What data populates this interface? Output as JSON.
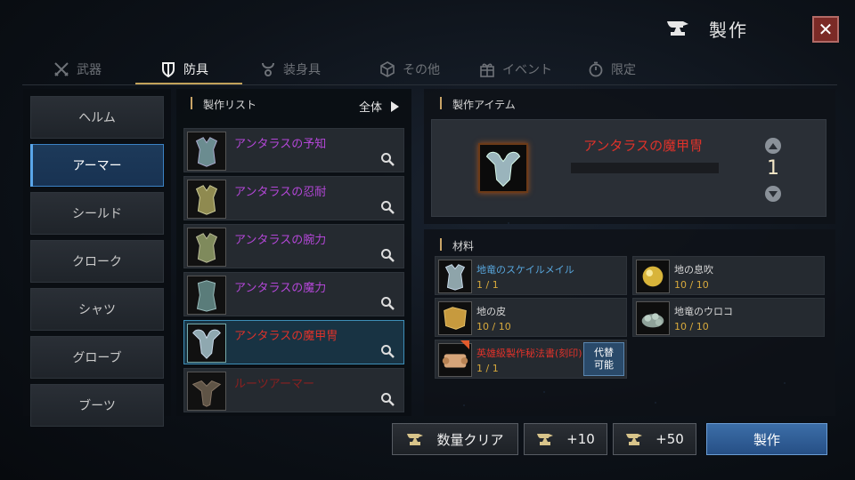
{
  "header": {
    "title": "製作",
    "icon": "anvil-icon",
    "close_icon": "close-icon"
  },
  "tabs": [
    {
      "label": "武器",
      "icon": "crossed-swords-icon",
      "active": false
    },
    {
      "label": "防具",
      "icon": "shield-icon",
      "active": true
    },
    {
      "label": "装身具",
      "icon": "necklace-icon",
      "active": false
    },
    {
      "label": "その他",
      "icon": "cube-icon",
      "active": false
    },
    {
      "label": "イベント",
      "icon": "gift-icon",
      "active": false
    },
    {
      "label": "限定",
      "icon": "stopwatch-icon",
      "active": false
    }
  ],
  "categories": [
    "ヘルム",
    "アーマー",
    "シールド",
    "クローク",
    "シャツ",
    "グローブ",
    "ブーツ"
  ],
  "selected_category": "アーマー",
  "craft_list": {
    "title": "製作リスト",
    "filter_label": "全体",
    "items": [
      {
        "name": "アンタラスの予知",
        "color": "#b447d8"
      },
      {
        "name": "アンタラスの忍耐",
        "color": "#b447d8"
      },
      {
        "name": "アンタラスの腕力",
        "color": "#b447d8"
      },
      {
        "name": "アンタラスの魔力",
        "color": "#b447d8"
      },
      {
        "name": "アンタラスの魔甲冑",
        "color": "#e0322a",
        "selected": true
      },
      {
        "name": "ルーツアーマー",
        "color": "#8a2020"
      }
    ]
  },
  "craft_item": {
    "section_title": "製作アイテム",
    "name": "アンタラスの魔甲冑",
    "quantity": "1"
  },
  "materials": {
    "section_title": "材料",
    "items": [
      {
        "name": "地竜のスケイルメイル",
        "count": "1 / 1",
        "name_color": "blue",
        "icon": "armor-icon"
      },
      {
        "name": "地の息吹",
        "count": "10 / 10",
        "name_color": "white",
        "icon": "golden-orb-icon"
      },
      {
        "name": "地の皮",
        "count": "10 / 10",
        "name_color": "white",
        "icon": "leather-icon"
      },
      {
        "name": "地竜のウロコ",
        "count": "10 / 10",
        "name_color": "white",
        "icon": "scales-icon"
      },
      {
        "name": "英雄級製作秘法書(刻印)",
        "count": "1 / 1",
        "name_color": "red",
        "icon": "scroll-icon",
        "substitute_label": "代替\n可能",
        "substitute_line1": "代替",
        "substitute_line2": "可能"
      }
    ]
  },
  "buttons": {
    "clear_label": "数量クリア",
    "plus10_label": "+10",
    "plus50_label": "+50",
    "craft_label": "製作"
  },
  "colors": {
    "accent_gold": "#c2a25a",
    "active_blue": "#3b82c4",
    "epic_purple": "#b447d8",
    "legendary_red": "#e0322a",
    "count_gold": "#d7a93c"
  }
}
